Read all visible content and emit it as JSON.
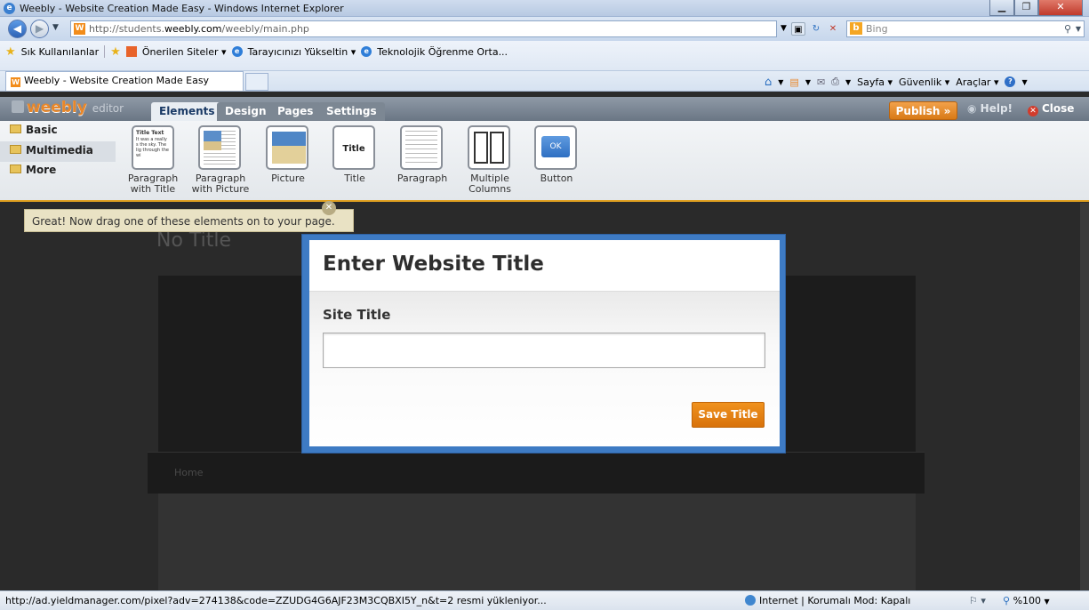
{
  "window": {
    "title": "Weebly - Website Creation Made Easy - Windows Internet Explorer",
    "min_icon": "minimize-icon",
    "max_icon": "maximize-icon",
    "close_icon": "close-icon"
  },
  "addressbar": {
    "url_host": "http://students.",
    "url_domain": "weebly.com",
    "url_path": "/weebly/main.php",
    "search_placeholder": "Bing"
  },
  "favbar": {
    "favorites": "Sık Kullanılanlar",
    "suggested": "Önerilen Siteler ▾",
    "upgrade": "Tarayıcınızı Yükseltin ▾",
    "tech": "Teknolojik Öğrenme Orta..."
  },
  "tab": {
    "label": "Weebly - Website Creation Made Easy"
  },
  "commandbar": {
    "page": "Sayfa ▾",
    "security": "Güvenlik ▾",
    "tools": "Araçlar ▾"
  },
  "weebly": {
    "logo": "weebly",
    "logo_suffix": "editor",
    "tabs": [
      "Elements",
      "Design",
      "Pages",
      "Settings"
    ],
    "publish": "Publish »",
    "help": "Help!",
    "close": "Close"
  },
  "categories": [
    "Basic",
    "Multimedia",
    "More"
  ],
  "elements": [
    {
      "label": "Paragraph\nwith Title",
      "line1": "Paragraph",
      "line2": "with Title"
    },
    {
      "label": "Paragraph with Picture",
      "line1": "Paragraph",
      "line2": "with Picture"
    },
    {
      "label": "Picture",
      "line1": "Picture",
      "line2": ""
    },
    {
      "label": "Title",
      "line1": "Title",
      "line2": ""
    },
    {
      "label": "Paragraph",
      "line1": "Paragraph",
      "line2": ""
    },
    {
      "label": "Multiple Columns",
      "line1": "Multiple",
      "line2": "Columns"
    },
    {
      "label": "Button",
      "line1": "Button",
      "line2": ""
    }
  ],
  "tile_text": {
    "title_text": "Title Text",
    "snippet": "It was a really s the sky. The lig through the wi",
    "ok": "OK"
  },
  "tip": "Great! Now drag one of these elements on to your page.",
  "canvas": {
    "ghost_title": "No Title",
    "ghost_home": "Home"
  },
  "modal": {
    "title": "Enter Website Title",
    "label": "Site Title",
    "input_value": "",
    "save": "Save Title"
  },
  "status": {
    "url": "http://ad.yieldmanager.com/pixel?adv=274138&code=ZZUDG4G6AJF23M3CQBXI5Y_n&t=2 resmi yükleniyor...",
    "zone": "Internet | Korumalı Mod: Kapalı",
    "zoom": "%100"
  }
}
